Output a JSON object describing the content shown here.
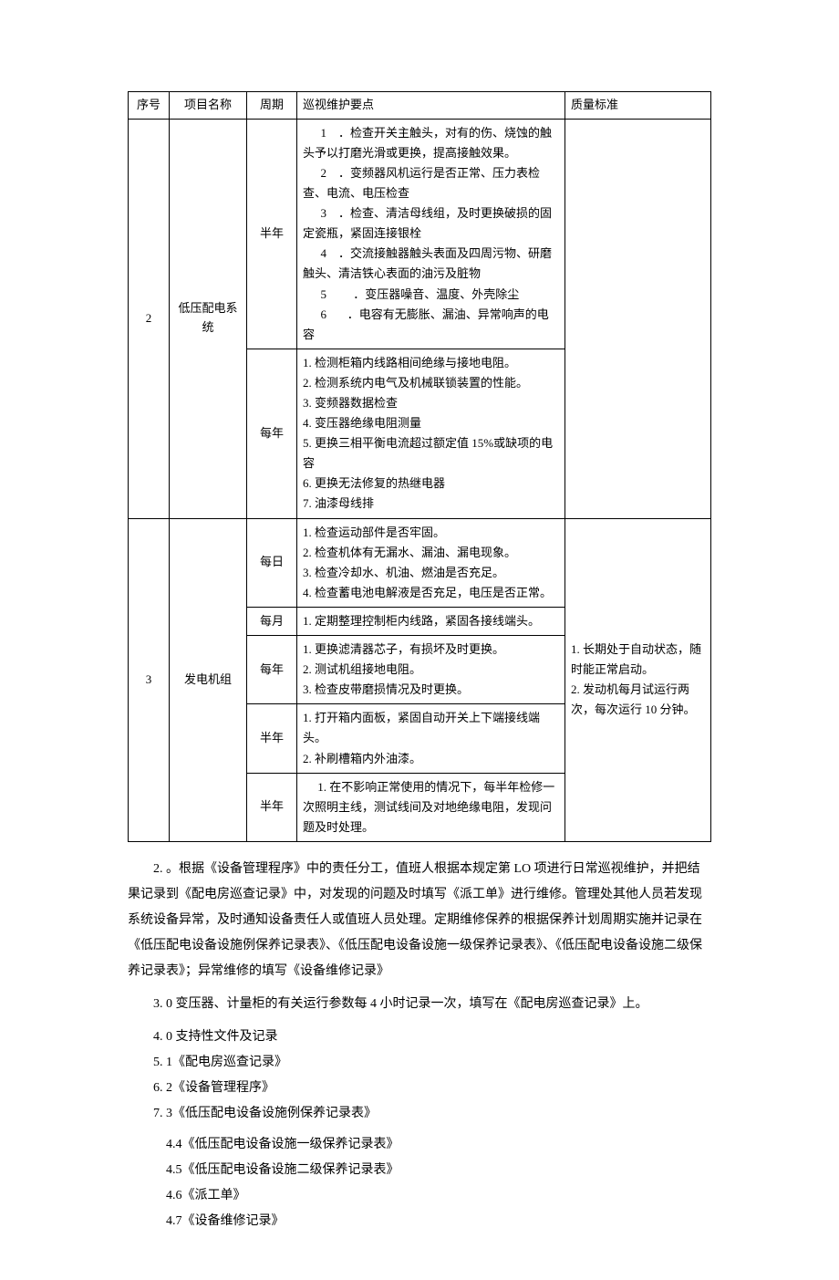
{
  "table": {
    "headers": {
      "seq": "序号",
      "name": "项目名称",
      "period": "周期",
      "points": "巡视维护要点",
      "standard": "质量标准"
    },
    "rows": [
      {
        "seq": "2",
        "name": "低压配电系统",
        "periods": [
          {
            "period": "半年",
            "points": "      1    ．检查开关主触头，对有的伤、烧蚀的触头予以打磨光滑或更换，提高接触效果。\n      2    ．变频器风机运行是否正常、压力表检查、电流、电压检查\n      3    ．检查、清洁母线组，及时更换破损的固定瓷瓶，紧固连接银栓\n      4    ．交流接触器触头表面及四周污物、研磨触头、清洁铁心表面的油污及脏物\n      5         ．变压器噪音、温度、外壳除尘\n      6       ．电容有无膨胀、漏油、异常响声的电容"
          },
          {
            "period": "每年",
            "points": "1. 检测柜箱内线路相间绝缘与接地电阻。\n2. 检测系统内电气及机械联锁装置的性能。\n3. 变频器数据检查\n4. 变压器绝缘电阻测量\n5. 更换三相平衡电流超过额定值 15%或缺项的电容\n6. 更换无法修复的热继电器\n7. 油漆母线排"
          }
        ],
        "standard": ""
      },
      {
        "seq": "3",
        "name": "发电机组",
        "periods": [
          {
            "period": "每日",
            "points": "1. 检查运动部件是否牢固。\n2. 检查机体有无漏水、漏油、漏电现象。\n3. 检查冷却水、机油、燃油是否充足。\n4. 检查蓄电池电解液是否充足，电压是否正常。"
          },
          {
            "period": "每月",
            "points": "1. 定期整理控制柜内线路，紧固各接线端头。"
          },
          {
            "period": "每年",
            "points": "1. 更换滤清器芯子，有损坏及时更换。\n2. 测试机组接地电阻。\n3. 检查皮带磨损情况及时更换。"
          },
          {
            "period": "半年",
            "points": "1. 打开箱内面板，紧固自动开关上下端接线端头。\n2. 补刷槽箱内外油漆。"
          },
          {
            "period": "半年",
            "points": "     1. 在不影响正常使用的情况下，每半年检修一次照明主线，测试线间及对地绝缘电阻，发现问题及时处理。"
          }
        ],
        "standard": "1. 长期处于自动状态，随时能正常启动。\n2. 发动机每月试运行两次，每次运行 10 分钟。"
      }
    ]
  },
  "paragraphs": {
    "p1": "2.     。根据《设备管理程序》中的责任分工，值班人根据本规定第 LO 项进行日常巡视维护，并把结果记录到《配电房巡查记录》中，对发现的问题及时填写《派工单》进行维修。管理处其他人员若发现系统设备异常，及时通知设备责任人或值班人员处理。定期维修保养的根据保养计划周期实施并记录在《低压配电设备设施例保养记录表》、《低压配电设备设施一级保养记录表》、《低压配电设备设施二级保养记录表》；异常维修的填写《设备维修记录》",
    "p2": "3.     0 变压器、计量柜的有关运行参数每 4 小时记录一次，填写在《配电房巡查记录》上。",
    "list": [
      "4.     0 支持性文件及记录",
      "5.     1《配电房巡查记录》",
      "6.     2《设备管理程序》",
      "7.     3《低压配电设备设施例保养记录表》"
    ],
    "items": [
      "4.4《低压配电设备设施一级保养记录表》",
      "4.5《低压配电设备设施二级保养记录表》",
      "4.6《派工单》",
      "4.7《设备维修记录》"
    ]
  }
}
